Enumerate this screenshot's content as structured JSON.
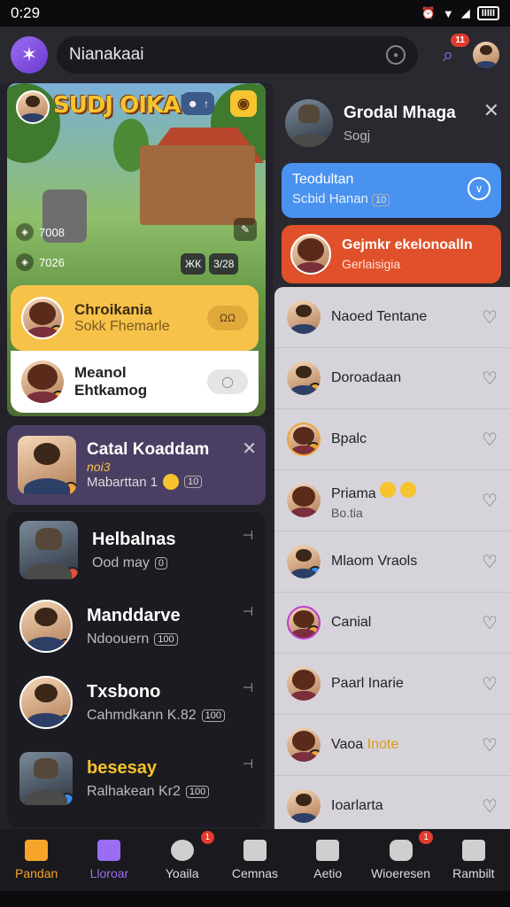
{
  "status": {
    "time": "0:29",
    "battery": "IIIII"
  },
  "topbar": {
    "search_text": "Nianakaai",
    "notif_count": "11"
  },
  "banner": {
    "game_title": "SUDJ OIKAH",
    "stat1": "7008",
    "stat2": "7026",
    "chip_label": "↑",
    "bottom_a": "ЖК",
    "bottom_b": "3/28"
  },
  "cards": {
    "yellow_title": "Chroikania",
    "yellow_sub": "Sokk Fhemarle",
    "yellow_pill": "ΩΩ",
    "white_title": "Meanol Ehtkamog"
  },
  "featured": {
    "title": "Catal Koaddam",
    "tag": "noi3",
    "sub": "Mabarttan 1",
    "extra": "10"
  },
  "chats": [
    {
      "title": "Helbalnas",
      "sub": "Ood may",
      "tag": "0"
    },
    {
      "title": "Manddarve",
      "sub": "Ndoouern",
      "tag": "100"
    },
    {
      "title": "Txsbono",
      "sub": "Cahmdkann K.82",
      "tag": "100"
    },
    {
      "title": "besesay",
      "sub": "Ralhakean Kr2",
      "tag": "100"
    }
  ],
  "right": {
    "header_title": "Grodal Mhaga",
    "header_sub": "Sogj",
    "blue_line1": "Teodultan",
    "blue_line2": "Scbid Hanan",
    "blue_tag": "10",
    "red_title": "Gejmkr ekelonoalln",
    "red_sub": "Gerlaisigia"
  },
  "contacts": [
    {
      "name": "Naoed Tentane",
      "sub": ""
    },
    {
      "name": "Doroadaan",
      "sub": ""
    },
    {
      "name": "Bpalc",
      "sub": ""
    },
    {
      "name": "Priama",
      "sub": "Bo.tia"
    },
    {
      "name": "Mlaom Vraols",
      "sub": ""
    },
    {
      "name": "Canial",
      "sub": ""
    },
    {
      "name": "Paarl Inarie",
      "sub": ""
    },
    {
      "name": "Vaoa",
      "name_hl": "Inote",
      "sub": ""
    },
    {
      "name": "Ioarlarta",
      "sub": ""
    }
  ],
  "nav": [
    {
      "label": "Pandan",
      "icon": "home-icon",
      "state": "active"
    },
    {
      "label": "Lloroar",
      "icon": "bag-icon",
      "state": "purple"
    },
    {
      "label": "Yoaila",
      "icon": "chat-icon",
      "state": "",
      "badge": "1"
    },
    {
      "label": "Cemnas",
      "icon": "house-icon",
      "state": ""
    },
    {
      "label": "Aetio",
      "icon": "grid-icon",
      "state": ""
    },
    {
      "label": "Wioeresen",
      "icon": "message-icon",
      "state": "",
      "badge": "1"
    },
    {
      "label": "Rambilt",
      "icon": "profile-icon",
      "state": ""
    }
  ]
}
